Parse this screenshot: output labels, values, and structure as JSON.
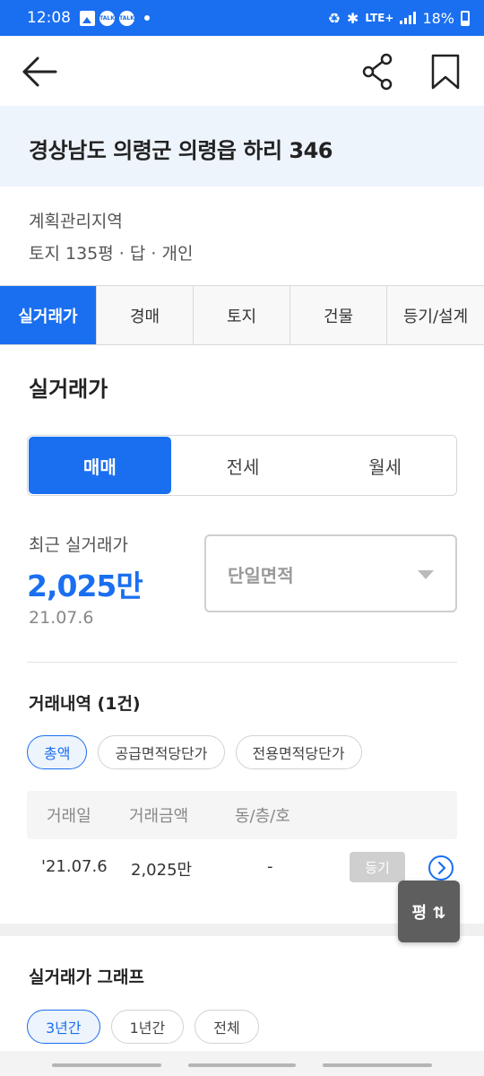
{
  "status_bar": {
    "time": "12:08",
    "network": "LTE+",
    "battery": "18%"
  },
  "header": {
    "back_icon": "arrow-left-icon",
    "share_icon": "share-icon",
    "bookmark_icon": "bookmark-icon"
  },
  "property": {
    "address": "경상남도 의령군 의령읍 하리 346",
    "zone": "계획관리지역",
    "summary": "토지 135평 · 답 · 개인"
  },
  "tabs": [
    {
      "label": "실거래가",
      "active": true
    },
    {
      "label": "경매",
      "active": false
    },
    {
      "label": "토지",
      "active": false
    },
    {
      "label": "건물",
      "active": false
    },
    {
      "label": "등기/설계",
      "active": false
    }
  ],
  "section": {
    "title": "실거래가",
    "deal_types": [
      {
        "label": "매매",
        "active": true
      },
      {
        "label": "전세",
        "active": false
      },
      {
        "label": "월세",
        "active": false
      }
    ]
  },
  "recent": {
    "label": "최근 실거래가",
    "price": "2,025만",
    "date": "21.07.6",
    "area_select": "단일면적"
  },
  "history": {
    "title": "거래내역 (1건)",
    "filters": [
      {
        "label": "총액",
        "active": true
      },
      {
        "label": "공급면적당단가",
        "active": false
      },
      {
        "label": "전용면적당단가",
        "active": false
      }
    ],
    "columns": [
      "거래일",
      "거래금액",
      "동/층/호"
    ],
    "rows": [
      {
        "date": "'21.07.6",
        "amount": "2,025만",
        "unit": "-",
        "badge": "등기"
      }
    ]
  },
  "unit_toggle": "평 ⇅",
  "graph": {
    "title": "실거래가 그래프",
    "periods": [
      {
        "label": "3년간",
        "active": true
      },
      {
        "label": "1년간",
        "active": false
      },
      {
        "label": "전체",
        "active": false
      }
    ]
  },
  "colors": {
    "accent": "#1a6ff0",
    "address_bg": "#eef4fc",
    "badge_gray": "#cfcfcf"
  }
}
